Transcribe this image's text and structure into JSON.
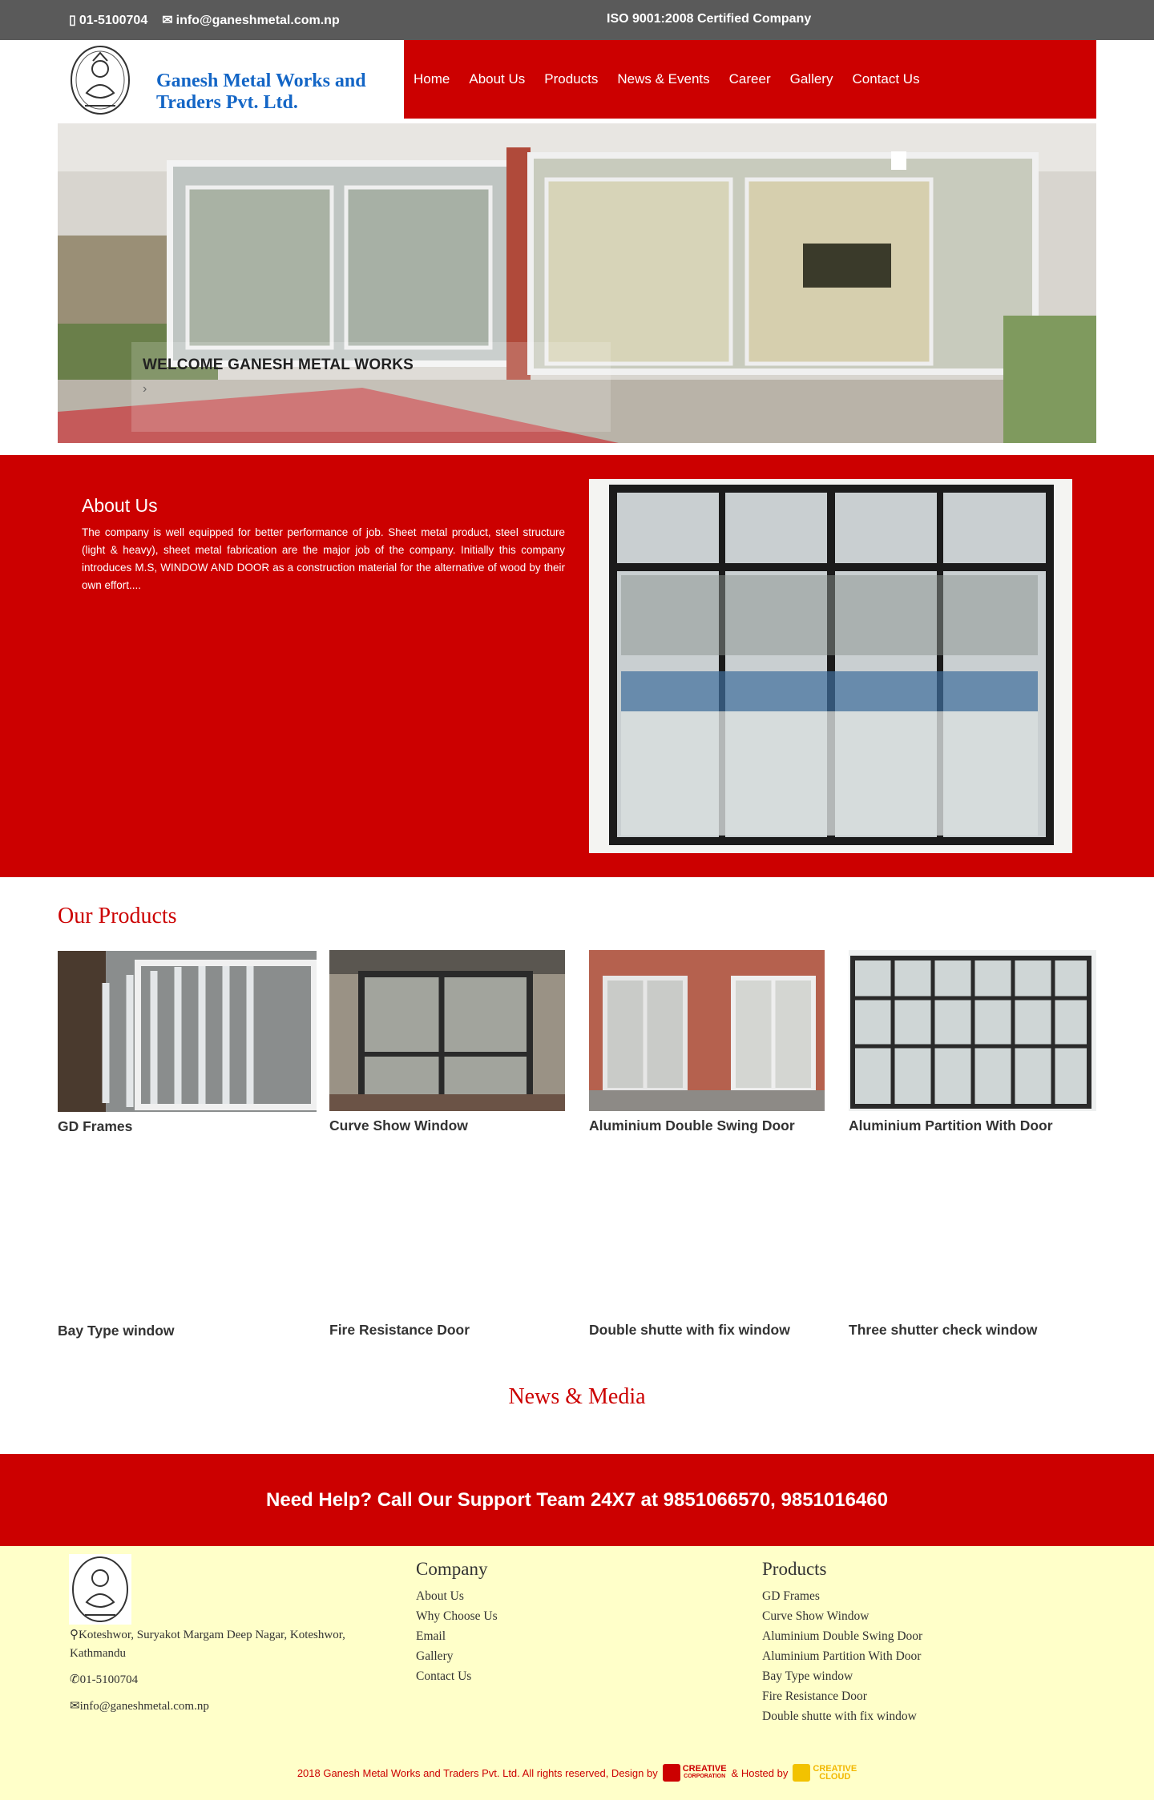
{
  "topbar": {
    "phone": "01-5100704",
    "email": "info@ganeshmetal.com.np",
    "certification": "ISO 9001:2008 Certified Company"
  },
  "header": {
    "brand_name": "Ganesh Metal Works and Traders Pvt. Ltd.",
    "nav": [
      "Home",
      "About Us",
      "Products",
      "News & Events",
      "Career",
      "Gallery",
      "Contact Us"
    ]
  },
  "hero": {
    "caption_title": "WELCOME GANESH METAL WORKS",
    "caption_arrow": "›"
  },
  "about": {
    "heading": "About Us",
    "text": "The company is well equipped for better performance of job. Sheet metal product, steel structure (light & heavy), sheet metal fabrication are the major job of the company. Initially this company introduces M.S, WINDOW AND DOOR as a construction material for the alternative of wood by their own effort...."
  },
  "products": {
    "heading": "Our Products",
    "items": [
      {
        "name": "GD Frames"
      },
      {
        "name": "Curve Show Window"
      },
      {
        "name": "Aluminium Double Swing Door"
      },
      {
        "name": "Aluminium Partition With Door"
      },
      {
        "name": "Bay Type window"
      },
      {
        "name": "Fire Resistance Door"
      },
      {
        "name": "Double shutte with fix window"
      },
      {
        "name": "Three shutter check window"
      }
    ]
  },
  "news": {
    "heading": "News & Media"
  },
  "help": {
    "text": "Need Help? Call Our Support Team 24X7 at 9851066570, 9851016460"
  },
  "footer": {
    "address": "Koteshwor, Suryakot Margam Deep Nagar, Koteshwor, Kathmandu",
    "phone": "01-5100704",
    "email": "info@ganeshmetal.com.np",
    "company_heading": "Company",
    "company_links": [
      "About Us",
      "Why Choose Us",
      "Email",
      "Gallery",
      "Contact Us"
    ],
    "products_heading": "Products",
    "product_links": [
      "GD Frames",
      "Curve Show Window",
      "Aluminium Double Swing Door",
      "Aluminium Partition With Door",
      "Bay Type window",
      "Fire Resistance Door",
      "Double shutte with fix window"
    ],
    "copyright": "2018 Ganesh Metal Works and Traders Pvt. Ltd. All rights reserved, Design by",
    "designer_line1": "CREATIVE",
    "designer_line2": "CORPORATION",
    "hosted_label": "& Hosted by",
    "host_line1": "CREATIVE",
    "host_line2": "CLOUD"
  },
  "colors": {
    "brand_red": "#cc0000",
    "brand_blue": "#1466c6",
    "topbar_gray": "#5a5a5a",
    "footer_bg": "#ffffc9"
  },
  "icons": {
    "phone": "mobile-icon",
    "email": "envelope-icon",
    "location": "map-marker-icon"
  }
}
